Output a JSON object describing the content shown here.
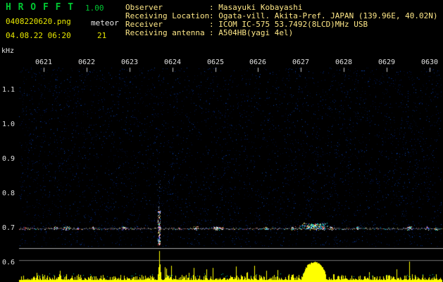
{
  "header": {
    "app_name": "H R O F F T",
    "version": "1.00",
    "filename": "0408220620.png",
    "mode": "meteor",
    "datetime": "04.08.22 06:20",
    "count": "21",
    "info": [
      {
        "label": "Observer",
        "value": ": Masayuki Kobayashi"
      },
      {
        "label": "Receiving Location",
        "value": ": Ogata-vill. Akita-Pref. JAPAN (139.96E, 40.02N)"
      },
      {
        "label": "Receiver",
        "value": ": ICOM IC-575 53.7492(8LCD)MHz USB"
      },
      {
        "label": "Receiving antenna",
        "value": ": A504HB(yagi 4el)"
      }
    ]
  },
  "colors": {
    "title_green": "#00c832",
    "accent_yellow": "#e8e800",
    "info_text": "#ffe888",
    "tick_text": "#e0e0e0",
    "level_yellow": "#ffff00",
    "level_cyan": "#00cc96",
    "line_major": "#a8a8a8",
    "line_minor": "#707070",
    "noise_blue": "#00175a",
    "carrier_gray": "#8a8a8a"
  },
  "chart_data": {
    "type": "heatmap",
    "title": "HROFFT 10-minute meteor radio echo spectrogram with signal-level strip",
    "x_axis": {
      "tick_labels": [
        "0621",
        "0622",
        "0623",
        "0624",
        "0625",
        "0626",
        "0627",
        "0628",
        "0629",
        "0630"
      ],
      "unit": "time HHMM"
    },
    "y_axis": {
      "label": "kHz",
      "tick_labels": [
        "1.1",
        "1.0",
        "0.9",
        "0.8",
        "0.7",
        "0.6"
      ],
      "range_khz": [
        0.6,
        1.17
      ]
    },
    "carrier_khz": 0.7,
    "meteor_count": 21,
    "echo_events": [
      {
        "time_label": "0624",
        "x_frac": 0.332,
        "freq_khz": 0.7,
        "kind": "underdense ping, broadband vertical streak",
        "level_height_frac": 0.92
      },
      {
        "time_label": "0627.5",
        "x_frac": 0.698,
        "freq_khz": 0.7,
        "kind": "overdense long-duration echo blob",
        "level_height_frac": 0.55,
        "width_frac": 0.055
      }
    ],
    "level_strip": {
      "baseline": "yellow noise floor with sparse spikes",
      "threshold_lines": 2,
      "cyan_dotted_trace": true
    },
    "render": {
      "seed": 1408,
      "noise_points": 5200,
      "carrier_clusters": 26
    }
  }
}
